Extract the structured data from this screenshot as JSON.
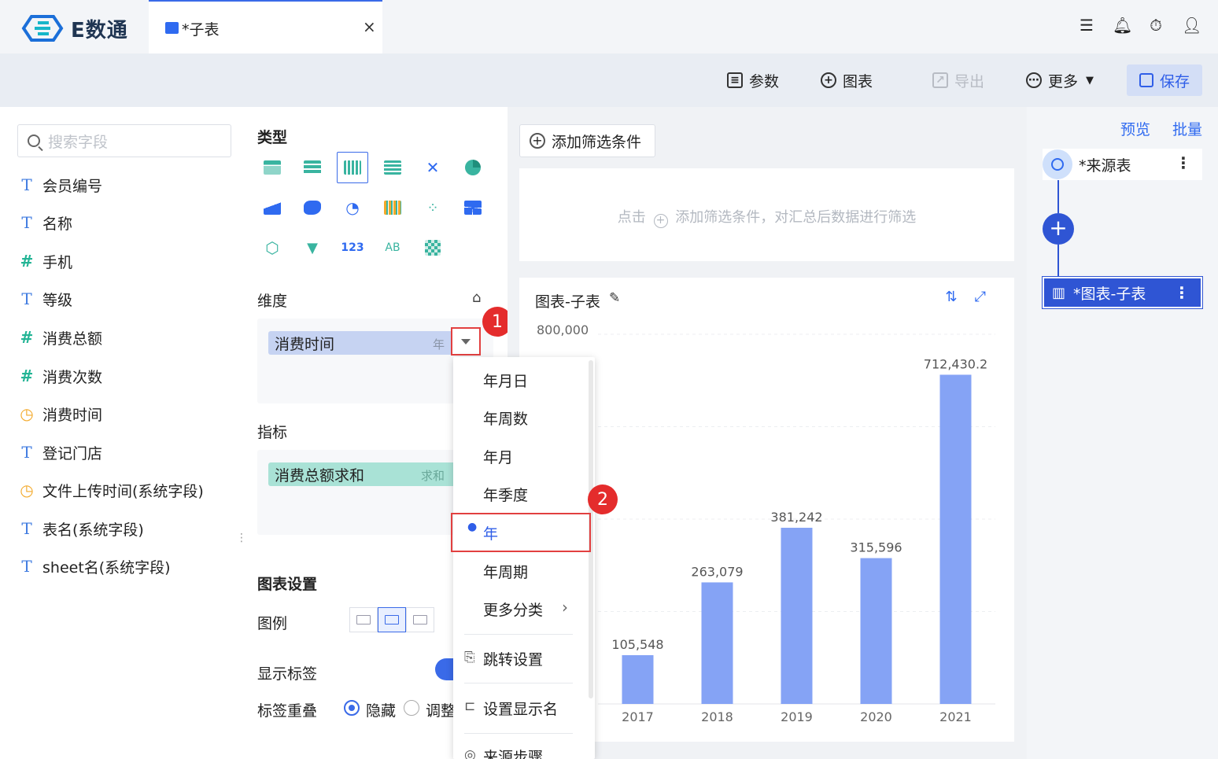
{
  "app": {
    "name": "E数通"
  },
  "tab": {
    "title": "*子表",
    "close": "×"
  },
  "toolbar": {
    "params": "参数",
    "chart": "图表",
    "export": "导出",
    "more": "更多",
    "save": "保存"
  },
  "left": {
    "search_placeholder": "搜索字段",
    "fields": [
      {
        "icon": "T",
        "name": "会员编号"
      },
      {
        "icon": "T",
        "name": "名称"
      },
      {
        "icon": "#",
        "name": "手机"
      },
      {
        "icon": "T",
        "name": "等级"
      },
      {
        "icon": "#",
        "name": "消费总额"
      },
      {
        "icon": "#",
        "name": "消费次数"
      },
      {
        "icon": "clock",
        "name": "消费时间"
      },
      {
        "icon": "T",
        "name": "登记门店"
      },
      {
        "icon": "clock",
        "name": "文件上传时间(系统字段)"
      },
      {
        "icon": "T",
        "name": "表名(系统字段)"
      },
      {
        "icon": "T",
        "name": "sheet名(系统字段)"
      }
    ]
  },
  "mid": {
    "type_title": "类型",
    "dimension_title": "维度",
    "dimension_pill": "消费时间",
    "dimension_tag": "年",
    "measure_title": "指标",
    "measure_pill": "消费总额求和",
    "measure_tag": "求和",
    "chart_settings_title": "图表设置",
    "legend_label": "图例",
    "show_label": "显示标签",
    "overlap_label": "标签重叠",
    "overlap_hide": "隐藏",
    "overlap_adjust": "调整"
  },
  "badges": {
    "one": "1",
    "two": "2"
  },
  "dropdown": {
    "items": [
      "年月日",
      "年周数",
      "年月",
      "年季度",
      "年",
      "年周期",
      "更多分类"
    ],
    "selected": "年",
    "actions": [
      "跳转设置",
      "设置显示名",
      "来源步骤"
    ]
  },
  "filter": {
    "button": "添加筛选条件",
    "hint_prefix": "点击",
    "hint_rest": "添加筛选条件，对汇总后数据进行筛选"
  },
  "chart_card": {
    "title": "图表-子表"
  },
  "chart_data": {
    "type": "bar",
    "categories": [
      "2017",
      "2018",
      "2019",
      "2020",
      "2021"
    ],
    "values": [
      105548,
      263079,
      381242,
      315596,
      712430.2
    ],
    "labels": [
      "105,548",
      "263,079",
      "381,242",
      "315,596",
      "712,430.2"
    ],
    "ylim": [
      0,
      800000
    ],
    "ytick_label": "800,000",
    "bar_color": "#85a3f5",
    "grid": true
  },
  "flow": {
    "preview": "预览",
    "batch": "批量",
    "source_node": "*来源表",
    "current_node": "*图表-子表"
  },
  "colors": {
    "accent": "#3a6ae8",
    "highlight": "#e24040",
    "dim_pill": "#c6d3f2",
    "measure_pill": "#a9e2d6"
  }
}
